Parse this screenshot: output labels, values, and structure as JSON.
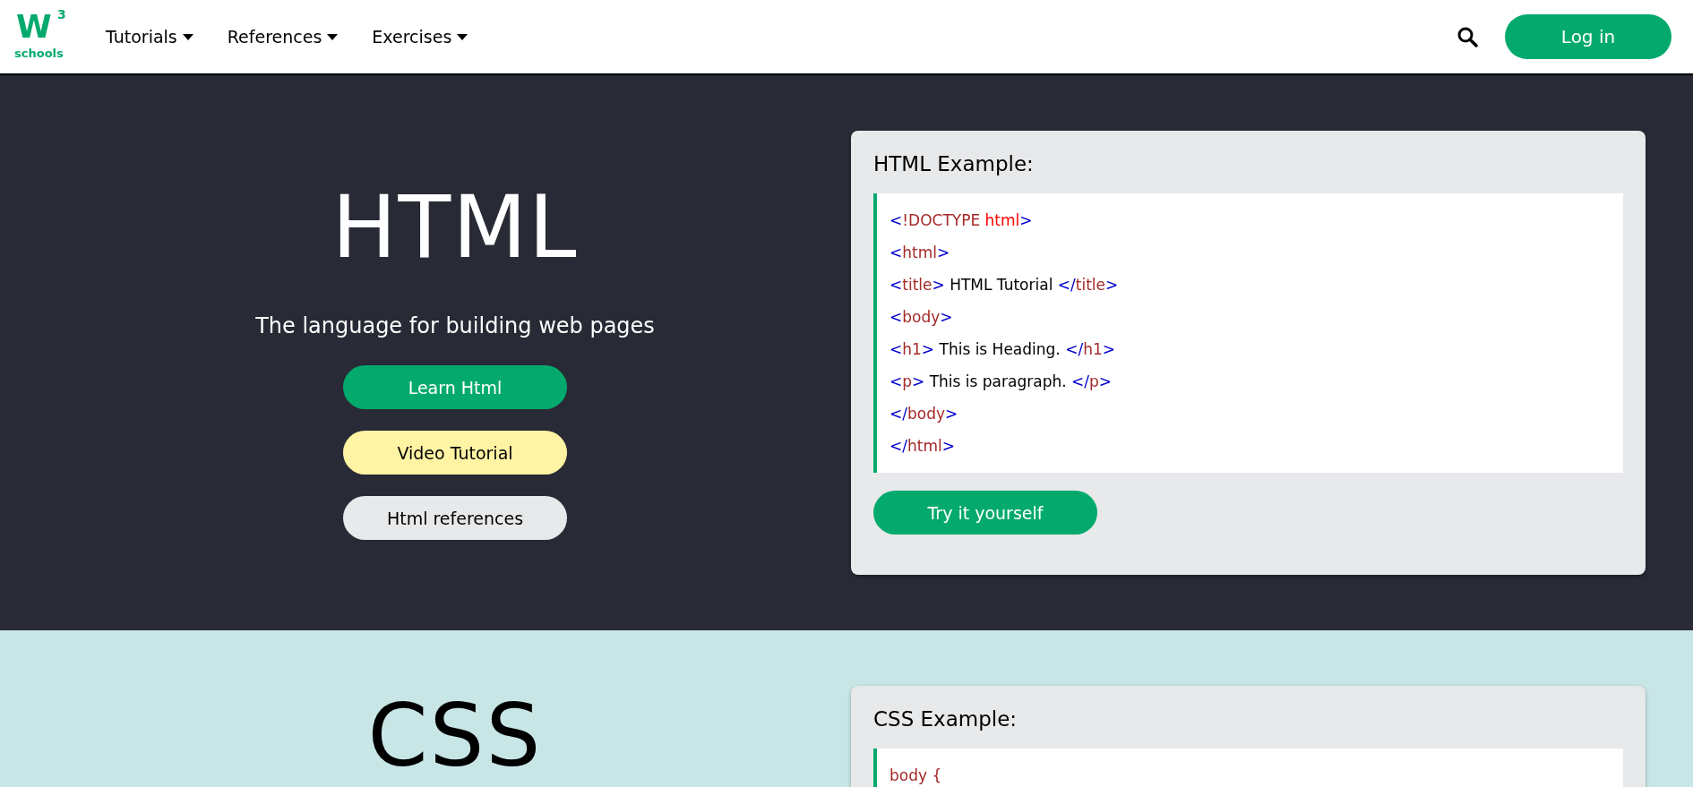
{
  "header": {
    "logo": {
      "mark": "W",
      "superscript": "3",
      "word": "schools"
    },
    "nav": [
      {
        "label": "Tutorials"
      },
      {
        "label": "References"
      },
      {
        "label": "Exercises"
      }
    ],
    "login": "Log in"
  },
  "sections": [
    {
      "kind": "dark",
      "title": "HTML",
      "tagline": "The language for building web pages",
      "buttons": [
        {
          "label": "Learn Html",
          "kind": "primary"
        },
        {
          "label": "Video Tutorial",
          "kind": "yellow"
        },
        {
          "label": "Html references",
          "kind": "grey"
        }
      ],
      "example": {
        "title": "HTML Example:",
        "button": "Try it yourself",
        "code": [
          [
            {
              "t": "<",
              "kind": "bracket"
            },
            {
              "t": "!DOCTYPE",
              "kind": "tag"
            },
            {
              "t": " html",
              "kind": "attr"
            },
            {
              "t": ">",
              "kind": "bracket"
            }
          ],
          [
            {
              "t": "<",
              "kind": "bracket"
            },
            {
              "t": "html",
              "kind": "tag"
            },
            {
              "t": ">",
              "kind": "bracket"
            }
          ],
          [
            {
              "t": "<",
              "kind": "bracket"
            },
            {
              "t": "title",
              "kind": "tag"
            },
            {
              "t": ">",
              "kind": "bracket"
            },
            {
              "t": " HTML Tutorial ",
              "kind": "text"
            },
            {
              "t": "</",
              "kind": "bracket"
            },
            {
              "t": "title",
              "kind": "tag"
            },
            {
              "t": ">",
              "kind": "bracket"
            }
          ],
          [
            {
              "t": "<",
              "kind": "bracket"
            },
            {
              "t": "body",
              "kind": "tag"
            },
            {
              "t": ">",
              "kind": "bracket"
            }
          ],
          [
            {
              "t": "<",
              "kind": "bracket"
            },
            {
              "t": "h1",
              "kind": "tag"
            },
            {
              "t": ">",
              "kind": "bracket"
            },
            {
              "t": " This is Heading. ",
              "kind": "text"
            },
            {
              "t": "</",
              "kind": "bracket"
            },
            {
              "t": "h1",
              "kind": "tag"
            },
            {
              "t": ">",
              "kind": "bracket"
            }
          ],
          [
            {
              "t": "<",
              "kind": "bracket"
            },
            {
              "t": "p",
              "kind": "tag"
            },
            {
              "t": ">",
              "kind": "bracket"
            },
            {
              "t": " This is paragraph. ",
              "kind": "text"
            },
            {
              "t": "</",
              "kind": "bracket"
            },
            {
              "t": "p",
              "kind": "tag"
            },
            {
              "t": ">",
              "kind": "bracket"
            }
          ],
          [
            {
              "t": "</",
              "kind": "bracket"
            },
            {
              "t": "body",
              "kind": "tag"
            },
            {
              "t": ">",
              "kind": "bracket"
            }
          ],
          [
            {
              "t": "</",
              "kind": "bracket"
            },
            {
              "t": "html",
              "kind": "tag"
            },
            {
              "t": ">",
              "kind": "bracket"
            }
          ]
        ]
      }
    },
    {
      "kind": "mint",
      "title": "CSS",
      "example": {
        "title": "CSS Example:",
        "code": [
          [
            {
              "t": "body {",
              "kind": "tag"
            }
          ]
        ]
      }
    }
  ]
}
